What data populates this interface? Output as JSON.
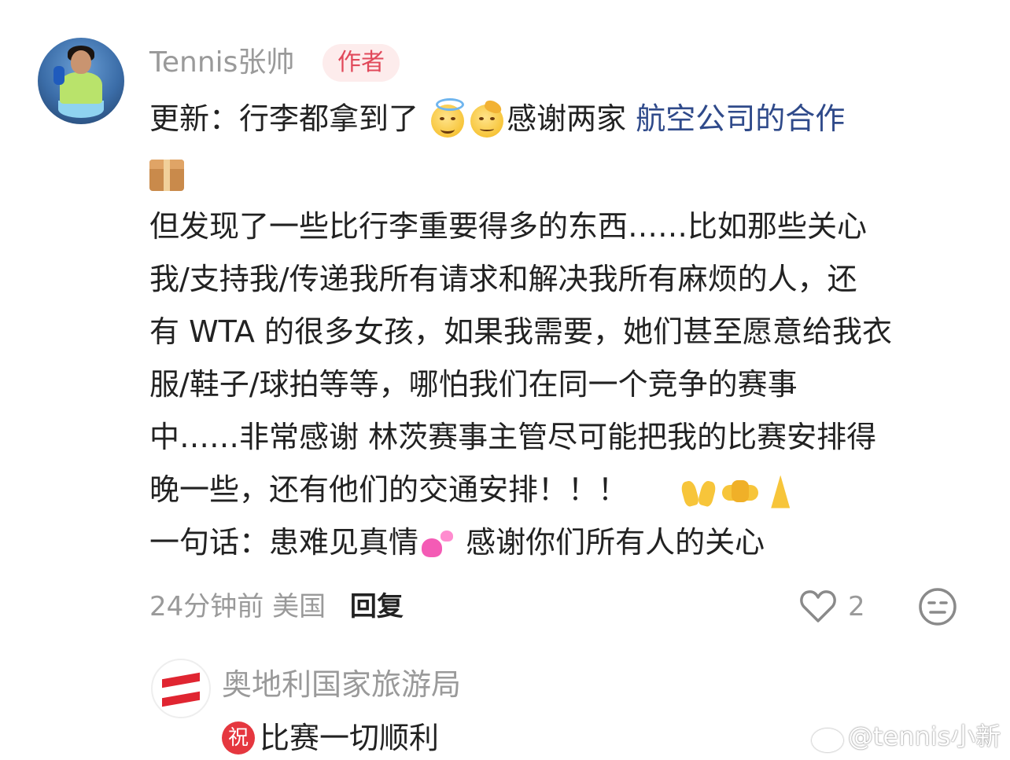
{
  "comment": {
    "username": "Tennis张帅",
    "author_badge": "作者",
    "lines": {
      "l1_a": "更新：行李都拿到了",
      "l1_b": "感谢两家",
      "l1_link": "航空公司的合作",
      "l3": "但发现了一些比行李重要得多的东西……比如那些关心",
      "l4": "我/支持我/传递我所有请求和解决我所有麻烦的人，还",
      "l5": "有 WTA 的很多女孩，如果我需要，她们甚至愿意给我衣",
      "l6": "服/鞋子/球拍等等，哪怕我们在同一个竞争的赛事",
      "l7": "中……非常感谢 林茨赛事主管尽可能把我的比赛安排得",
      "l8": "晚一些，还有他们的交通安排！！！",
      "l9_a": "一句话：患难见真情",
      "l9_b": "感谢你们所有人的关心"
    },
    "emojis": [
      "smiling-face-with-halo",
      "saluting-face",
      "package",
      "raising-hands",
      "handshake",
      "folded-hands",
      "two-hearts"
    ],
    "time": "24分钟前",
    "location": "美国",
    "reply_label": "回复",
    "like_count": "2"
  },
  "reply": {
    "username": "奥地利国家旅游局",
    "badge": "祝",
    "text": "比赛一切顺利"
  },
  "watermark": "@tennis小新",
  "colors": {
    "link": "#2f4a8a",
    "badge_text": "#e1495a",
    "badge_bg": "#fdecec",
    "meta_gray": "#9a9a9a",
    "congrats_red": "#e5373f"
  }
}
